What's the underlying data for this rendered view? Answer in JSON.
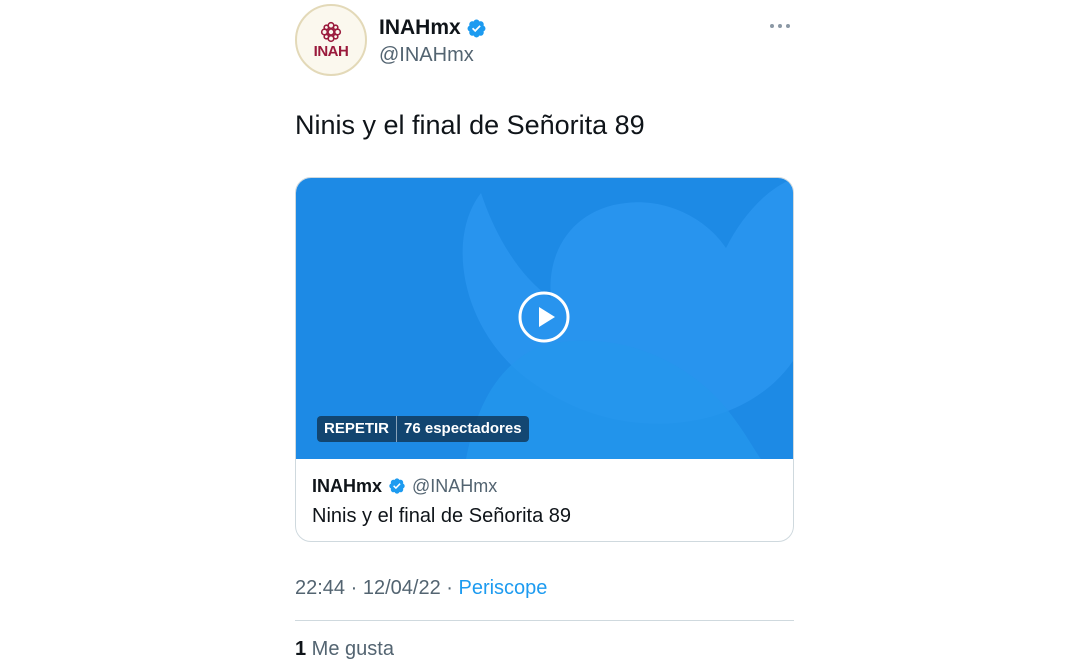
{
  "tweet": {
    "author": {
      "name": "INAHmx",
      "handle": "@INAHmx",
      "avatar_text": "INAH",
      "verified": true
    },
    "text": "Ninis y el final de Señorita 89",
    "media": {
      "badge_replay": "REPETIR",
      "badge_viewers": "76 espectadores",
      "background_color": "#1d8ae5"
    },
    "card": {
      "author_name": "INAHmx",
      "author_handle": "@INAHmx",
      "text": "Ninis y el final de Señorita 89"
    },
    "meta": {
      "time": "22:44",
      "separator": " · ",
      "date": "12/04/22",
      "source": "Periscope"
    },
    "likes": {
      "count": "1",
      "label": " Me gusta"
    }
  },
  "colors": {
    "accent": "#1d9bf0",
    "brand": "#9a1a3c",
    "text_secondary": "#536471"
  }
}
